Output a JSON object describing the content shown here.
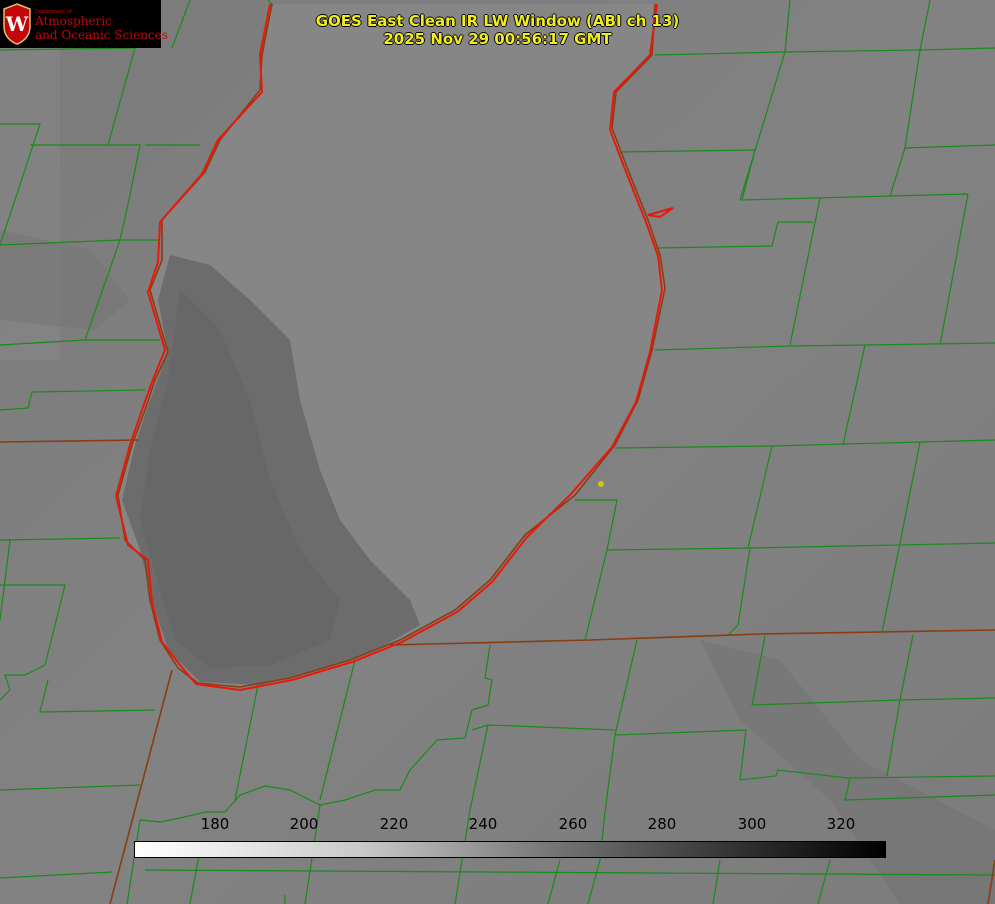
{
  "title": {
    "line1": "GOES East Clean IR LW Window (ABI ch 13)",
    "line2": "2025 Nov 29 00:56:17 GMT"
  },
  "logo": {
    "department": "Department of",
    "line1": "Atmospheric",
    "line2": "and Oceanic Sciences",
    "seal_letter": "W"
  },
  "colorbar": {
    "ticks": [
      "180",
      "200",
      "220",
      "240",
      "260",
      "280",
      "300",
      "320"
    ],
    "gradient_start": "#ffffff",
    "gradient_end": "#000000"
  },
  "colors": {
    "county_lines": "#1a8a1a",
    "state_lines": "#8a3d10",
    "shoreline": "#e8180c",
    "title_text": "#f2ee1c",
    "marker": "#d8c21a"
  }
}
